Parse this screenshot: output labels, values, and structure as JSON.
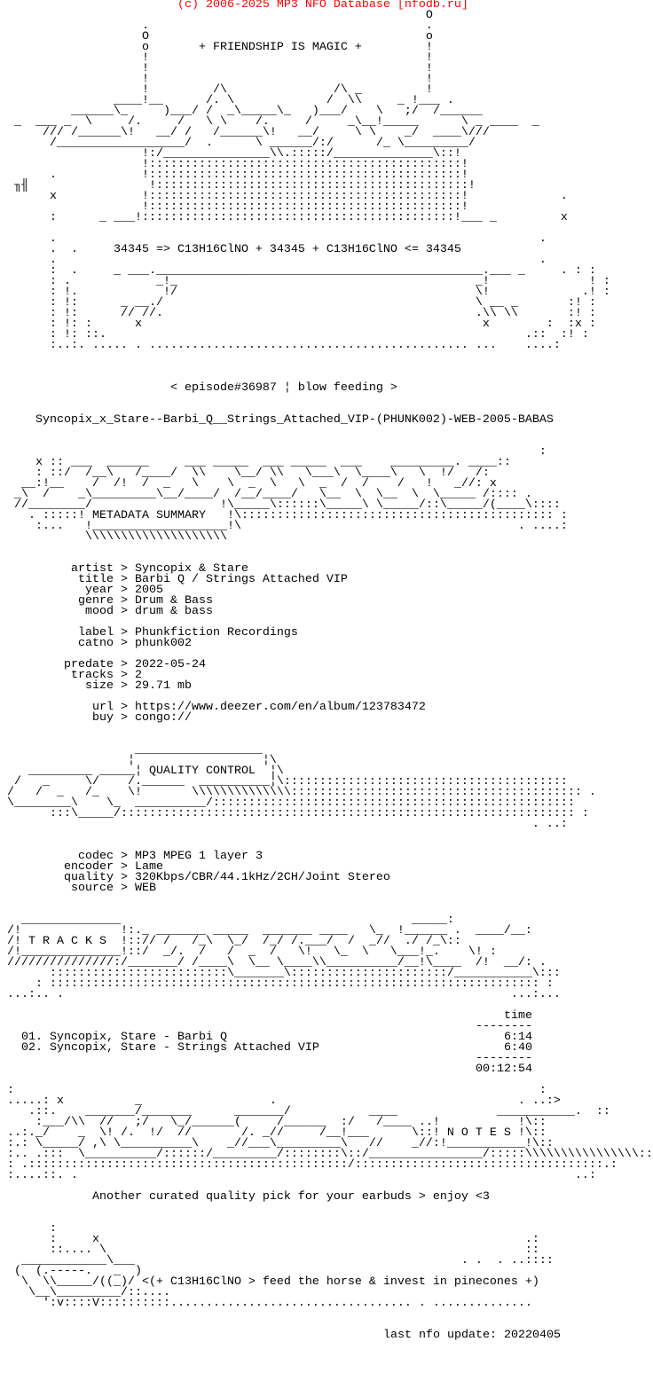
{
  "header": {
    "copyright": "                         (c) 2006-2025 MP3 NFO Database [nfodb.ru]",
    "accent_color": "#ff0000"
  },
  "banner": {
    "lines": [
      "                                                            O",
      "                    .                                       .",
      "                    O                                       o",
      "                    o       + FRIENDSHIP IS MAGIC +         !",
      "                    !                                       !",
      "                    !                                       !",
      "                    !                                       !",
      "                    !         /\\               /\\ _         !",
      "                ____!__      /. \\             /  \\\\     _ !___ .",
      "          ______\\_     )___/ /  _\\_____\\_   )___/    \\   ;/  /______",
      "  _  ___ _  \\     /.     /   \\ \\    /.     /     _\\__!_____      \\ _ ____  _",
      "      /// /______\\!   __/ /   /______\\!   __/     \\ \\    _/  ____\\///",
      "       /__________________/  .      \\ ______/:/      /_ \\_________/",
      "                    !:/_______________\\\\.:::::/______________\\::!",
      "                    !::::::::::::::::::::::::::::::::::::::::::::!",
      "       .            !::::::::::::::::::::::::::::::::::::::::::::!",
      "  ╖╢                 !::::::::::::::::::::::::::::::::::::::::::::!",
      "       x            !::::::::::::::::::::::::::::::::::::::::::::!             .",
      "                    !::::::::::::::::::::::::::::::::::::::::::::!",
      "       :      _ ___!::::::::::::::::::::::::::::::::::::::::::::!___ _         x",
      "",
      "       .                                                                    .",
      "       .  .     34345 => C13H16ClNO + 34345 + C13H16ClNO <= 34345",
      "       .                                                                    .",
      "       :  .     _ ___.______________________________________________.___ _     . : :",
      "       : .            _!_                                          _!              ! :",
      "       : !.            !/                                          \\!             .! :",
      "       : !:      _ __./                                            \\ __ _       :! :",
      "       : !:      // //.                                            .\\\\ \\\\       :! :",
      "       : !: :      x                                                x        :  :x :",
      "       : !: ::.                                                           .::  :! :",
      "       :..:. ..... . ............................................. ...    ....:"
    ]
  },
  "episode": {
    "line": "                        < episode#36987 ¦ blow feeding >"
  },
  "release": {
    "name": "     Syncopix_x_Stare--Barbi_Q__Strings_Attached_VIP-(PHUNK002)-WEB-2005-BABAS"
  },
  "metadata_section": {
    "title": "METADATA SUMMARY",
    "art_lines": [
      "                                                                            :",
      "     x :: ___  ______     ___ _____  ___ _____  ___    _________. ____::",
      "     : ::/  /__\\   /____/  \\\\    \\__/ \\\\   \\___\\  \\____\\   \\  !/   /:",
      "   __:!__    /  /!  /  _   \\    \\  _  \\   \\  _  /  /    /   !   _//: x",
      "  _\\  /    _\\_________\\__/____/  /__/____/   \\__  \\  \\__  \\  \\_____ /:::: .",
      "  //________/                  !\\_____\\::::::\\_____\\ \\_____/::\\_____/(____\\::::",
      "    . :::::! METADATA SUMMARY   !\\:::::::::::::::::::::::::::::::::::::::::::: :",
      "     :...   !___________________!\\                                       . ....:",
      "            \\\\\\\\\\\\\\\\\\\\\\\\\\\\\\\\\\\\\\\\"
    ],
    "fields": [
      {
        "key": "artist",
        "value": "Syncopix & Stare"
      },
      {
        "key": "title",
        "value": "Barbi Q / Strings Attached VIP"
      },
      {
        "key": "year",
        "value": "2005"
      },
      {
        "key": "genre",
        "value": "Drum & Bass"
      },
      {
        "key": "mood",
        "value": "drum & bass"
      },
      {
        "key": "",
        "value": ""
      },
      {
        "key": "label",
        "value": "Phunkfiction Recordings"
      },
      {
        "key": "catno",
        "value": "phunk002"
      },
      {
        "key": "",
        "value": ""
      },
      {
        "key": "predate",
        "value": "2022-05-24"
      },
      {
        "key": "tracks",
        "value": "2"
      },
      {
        "key": "size",
        "value": "29.71 mb"
      },
      {
        "key": "",
        "value": ""
      },
      {
        "key": "url",
        "value": "https://www.deezer.com/en/album/123783472"
      },
      {
        "key": "buy",
        "value": "congo://"
      }
    ]
  },
  "quality_section": {
    "title": "QUALITY CONTROL",
    "art_lines": [
      "                   __________________",
      "                  ¦                  ¦\\",
      "    _________ _____¦ QUALITY CONTROL  ¦\\",
      "  /   _     \\/    /.______  __________¦\\::::::::::::::::::::::::::::::::::::::::",
      " /   /  _   /_    \\!       \\\\\\\\\\\\\\\\\\\\\\\\\\\\::::::::::::::::::::::::::::::::::::::::: .",
      " \\________\\    \\_  __________/:::::::::::::::::::::::::::::::::::::::::::::::::::",
      "       :::\\_____/:::::::::::::::::::::::::::::::::::::::::::::::::::::::::::::::: :",
      "                                                                           . ..:"
    ],
    "fields": [
      {
        "key": "codec",
        "value": "MP3 MPEG 1 layer 3"
      },
      {
        "key": "encoder",
        "value": "Lame"
      },
      {
        "key": "quality",
        "value": "320Kbps/CBR/44.1kHz/2CH/Joint Stereo"
      },
      {
        "key": "source",
        "value": "WEB"
      }
    ]
  },
  "tracks_section": {
    "title": "T R A C K S",
    "art_lines": [
      "   ______________                                         _____:",
      " /!              !:._ _______ _____  _______ ____   \\_  !______ .  ____/__:",
      " /! T R A C K S  !::// /   /_\\  \\_/  /_/ /.___/  /  _//  ./ /_\\::",
      " /!______________!::/  _/.  /   /  _  /   \\!   \\_  \\   \\___!_.    \\! :",
      " ///////////////:/_______/ /____\\  \\__ \\____\\\\__________/__!\\____  /!  __/: .",
      "       :::::::::::::::::::::::::\\_______\\::::::::::::::::::::::/___________\\:::",
      "     : ::::::::::::::::::::::::::::::::::::::::::::::::::::::::::::::::::::: :",
      " ...:.. .                                                               ...:..."
    ],
    "time_header": "time",
    "separator": "--------",
    "list": [
      {
        "num": "01.",
        "title": "Syncopix, Stare - Barbi Q",
        "time": "6:14"
      },
      {
        "num": "02.",
        "title": "Syncopix, Stare - Strings Attached VIP",
        "time": "6:40"
      }
    ],
    "total": "00:12:54"
  },
  "notes_section": {
    "title": "N O T E S",
    "art_lines": [
      " :                                                                          :",
      " .....: x          _                  .                                  . ..:>",
      "    .::.    _______/_______      _______/           ____              ___________.  ::",
      "     :___/\\\\  //   ;/   \\_/______(     /______  :/   /____ ..!           !\\::",
      " ..:._/    _  \\! /.  !/  //       /. _//     /__!___      \\::! N O T E S !\\::",
      " :.: \\_____/ ,\\ \\__________\\    _//___\\_________\\   //    _//:!___________!\\::",
      " :.. .:::  \\__________/::::::/_________/::::::::\\::/________________/:::::\\\\\\\\\\\\\\\\\\\\\\\\\\\\\\\\::..",
      " : .:::::::::::::::::::::::::::::::::::::::::::::/:::::::::::::::::::::::::::::::::::.:",
      " :....::. .                                                                      ..:"
    ],
    "message": "             Another curated quality pick for your earbuds > enjoy <3"
  },
  "footer": {
    "art_lines": [
      "       :",
      "       :     x                                                            .:",
      "       ::.... \\                                                           ::",
      "   ____________\\___                                              . .  . ..::::",
      "  (  (.-----.   _  )",
      "   \\  \\\\_____/((_)/ <(+ C13H16ClNO > feed the horse & invest in pinecones +)",
      "    \\__\\_________/::....",
      "      ':v::::V::::::::::.................................. . .............."
    ],
    "last_update_label": "last nfo update:",
    "last_update_value": "20220405"
  }
}
